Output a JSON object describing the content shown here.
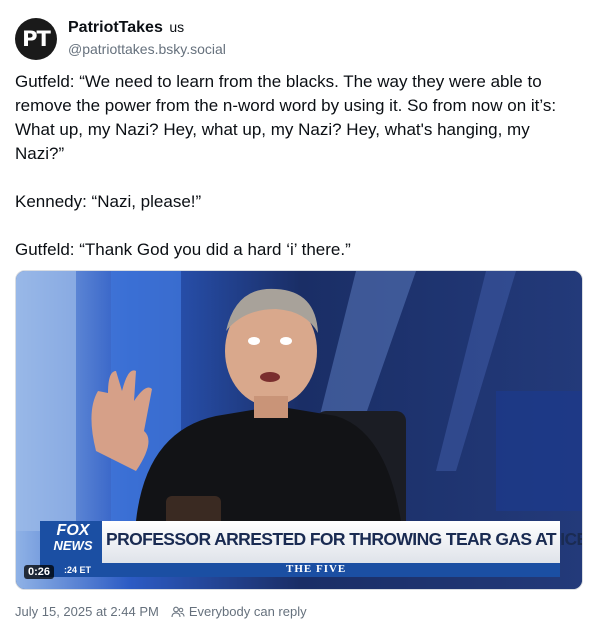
{
  "author": {
    "avatar_text": "PT",
    "display_name": "PatriotTakes",
    "verified_badge": "us",
    "handle": "@patriottakes.bsky.social"
  },
  "post": {
    "paragraphs": [
      "Gutfeld: “We need to learn from the blacks. The way they were able to remove the power from the n-word word by using it. So from now on it’s: What up, my Nazi? Hey, what up, my Nazi? Hey, what's hanging, my Nazi?”",
      "Kennedy: “Nazi, please!”",
      "Gutfeld: “Thank God you did a hard ‘i’ there.”"
    ]
  },
  "media": {
    "network_logo_line1": "FOX",
    "network_logo_line2": "NEWS",
    "chyron_headline": "PROFESSOR ARRESTED FOR THROWING TEAR GAS AT ICE",
    "show_name": "THE FIVE",
    "clock": ":24 ET",
    "video_time": "0:26"
  },
  "footer": {
    "timestamp": "July 15, 2025 at 2:44 PM",
    "reply_setting": "Everybody can reply",
    "reply_icon": "people-icon"
  },
  "colors": {
    "chyron_blue": "#1b4fa3",
    "chyron_white": "#f4f4f4",
    "muted_text": "#66717d",
    "studio_blue": "#1f49a8"
  }
}
